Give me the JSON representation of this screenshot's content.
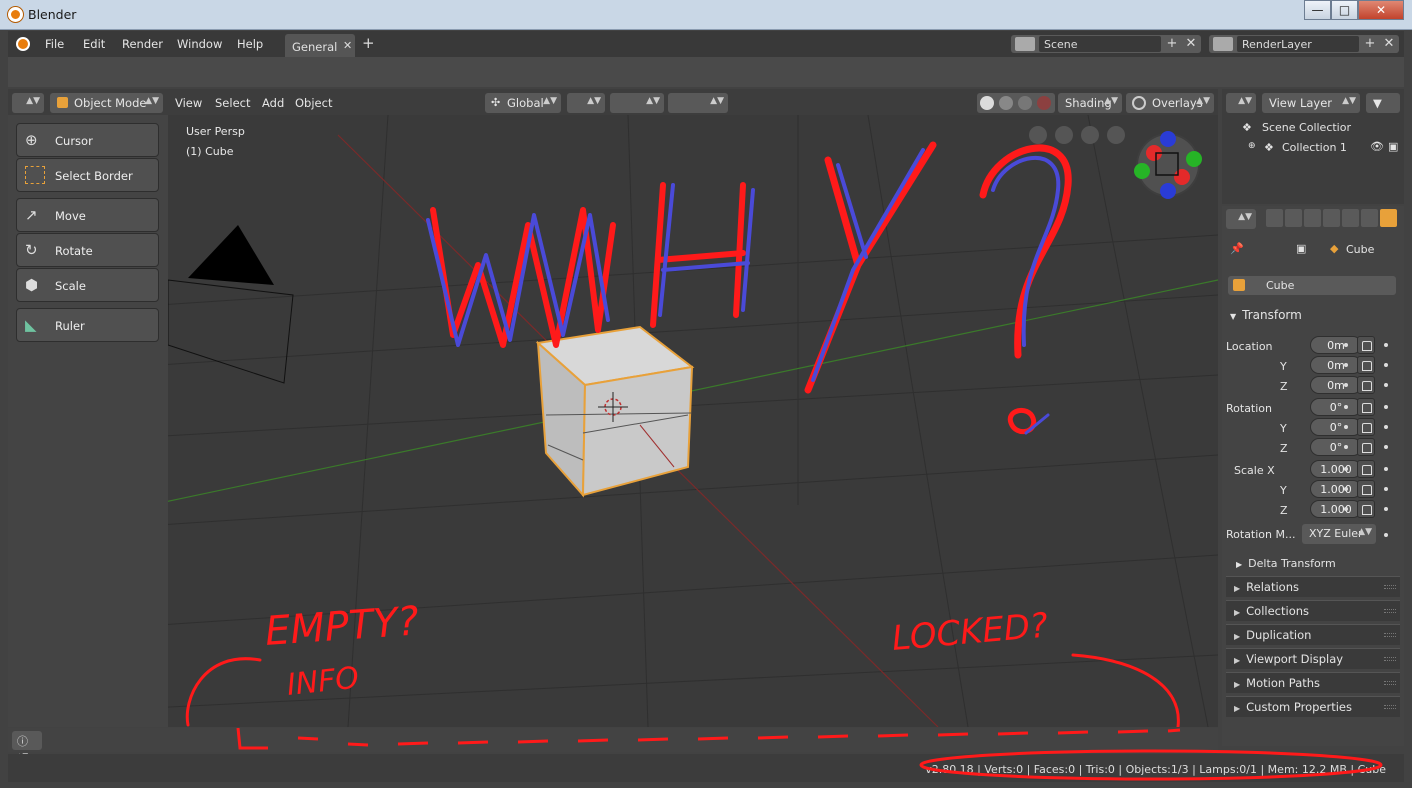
{
  "window": {
    "title": "Blender",
    "min": "—",
    "max": "□",
    "close": "✕"
  },
  "menubar": {
    "items": [
      "File",
      "Edit",
      "Render",
      "Window",
      "Help"
    ],
    "workspace_tab": "General",
    "tab_close": "✕",
    "tab_add": "+"
  },
  "scene": {
    "name": "Scene",
    "layer": "RenderLayer",
    "add": "+",
    "remove": "✕"
  },
  "viewport_header": {
    "mode": "Object Mode",
    "menus": [
      "View",
      "Select",
      "Add",
      "Object"
    ],
    "orientation": "Global",
    "shading": "Shading",
    "overlays": "Overlays"
  },
  "viewport": {
    "view_name": "User Persp",
    "object_label": "(1) Cube"
  },
  "toolbar": {
    "tools": [
      "Cursor",
      "Select Border",
      "Move",
      "Rotate",
      "Scale",
      "Ruler"
    ]
  },
  "annotations": {
    "why": "WHY?",
    "empty": "EMPTY?",
    "info": "INFO",
    "locked": "LOCKED?"
  },
  "outliner": {
    "view_layer": "View Layer",
    "scene_collection": "Scene Collectior",
    "collection": "Collection 1"
  },
  "properties": {
    "breadcrumb_object": "Cube",
    "object_name": "Cube",
    "transform_title": "Transform",
    "location_label": "Location",
    "rotation_label": "Rotation",
    "scale_label": "Scale X",
    "axis_y": "Y",
    "axis_z": "Z",
    "location": [
      "0m",
      "0m",
      "0m"
    ],
    "rotation": [
      "0°",
      "0°",
      "0°"
    ],
    "scale": [
      "1.000",
      "1.000",
      "1.000"
    ],
    "rotation_mode_label": "Rotation M...",
    "rotation_mode": "XYZ Euler",
    "delta_transform": "Delta Transform",
    "panels": [
      "Relations",
      "Collections",
      "Duplication",
      "Viewport Display",
      "Motion Paths",
      "Custom Properties"
    ]
  },
  "status": {
    "stats": "v2.80.18 | Verts:0 | Faces:0 | Tris:0 | Objects:1/3 | Lamps:0/1 | Mem: 12.2 MB | Cube"
  },
  "colors": {
    "accent": "#e87d0d",
    "annotation_red": "#ff1a1a",
    "annotation_blue": "#4a4ad8"
  }
}
